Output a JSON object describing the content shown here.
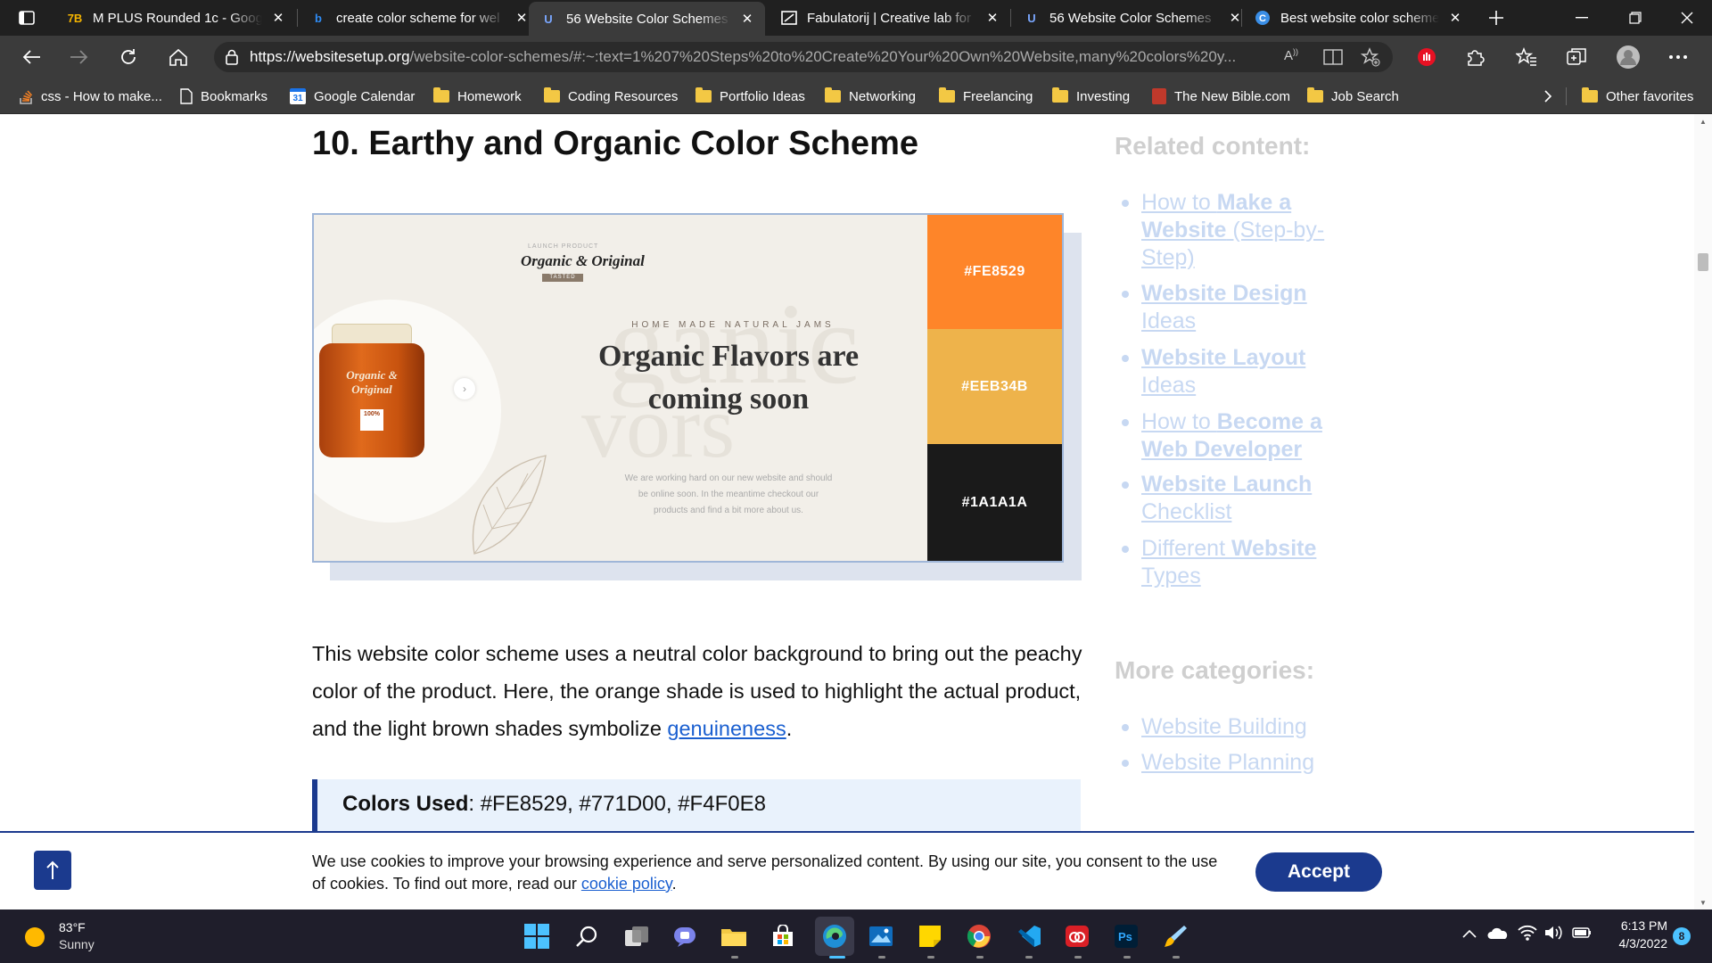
{
  "browser": {
    "tabs": [
      {
        "title": "M PLUS Rounded 1c - Goog",
        "favicon": "google-fonts-icon"
      },
      {
        "title": "create color scheme for wel",
        "favicon": "bing-icon"
      },
      {
        "title": "56 Website Color Schemes",
        "favicon": "websitesetup-icon",
        "active": true
      },
      {
        "title": "Fabulatorij | Creative lab for",
        "favicon": "fabulatorij-icon"
      },
      {
        "title": "56 Website Color Schemes",
        "favicon": "websitesetup-icon"
      },
      {
        "title": "Best website color scheme",
        "favicon": "edge-copilot-icon"
      }
    ],
    "address": {
      "domain": "https://websitesetup.org",
      "path": "/website-color-schemes/#:~:text=1%207%20Steps%20to%20Create%20Your%20Own%20Website,many%20colors%20y..."
    },
    "bookmarks": [
      {
        "label": "css - How to make...",
        "icon": "stackoverflow-icon"
      },
      {
        "label": "Bookmarks",
        "icon": "page-icon"
      },
      {
        "label": "Google Calendar",
        "icon": "calendar-icon",
        "badge": "31"
      },
      {
        "label": "Homework",
        "icon": "folder-icon"
      },
      {
        "label": "Coding Resources",
        "icon": "folder-icon"
      },
      {
        "label": "Portfolio Ideas",
        "icon": "folder-icon"
      },
      {
        "label": "Networking",
        "icon": "folder-icon"
      },
      {
        "label": "Freelancing",
        "icon": "folder-icon"
      },
      {
        "label": "Investing",
        "icon": "folder-icon"
      },
      {
        "label": "The New Bible.com",
        "icon": "bible-icon"
      },
      {
        "label": "Job Search",
        "icon": "folder-icon"
      }
    ],
    "other_favorites": "Other favorites"
  },
  "article": {
    "heading": "10. Earthy and Organic Color Scheme",
    "preview": {
      "eyebrow": "LAUNCH PRODUCT",
      "brand": "Organic & Original",
      "brand_tag": "TASTED",
      "subhead": "HOME MADE NATURAL JAMS",
      "headline_1": "Organic Flavors are",
      "headline_2": "coming soon",
      "body_1": "We are working hard on our new website and should",
      "body_2": "be online soon. In the meantime checkout our",
      "body_3": "products and find a bit more about us.",
      "jar_label": "Organic & Original",
      "jar_badge": "100%",
      "swatches": [
        {
          "hex": "#FE8529",
          "color": "#FE8529"
        },
        {
          "hex": "#EEB34B",
          "color": "#EEB34B"
        },
        {
          "hex": "#1A1A1A",
          "color": "#1A1A1A"
        }
      ]
    },
    "para_before": "This website color scheme uses a neutral color background to bring out the peachy color of the product. Here, the orange shade is used to highlight the actual product, and the light brown shades symbolize ",
    "para_link": "genuineness",
    "para_after": ".",
    "colors_label": "Colors Used",
    "colors_value": ": #FE8529, #771D00, #F4F0E8"
  },
  "sidebar": {
    "related_heading": "Related content:",
    "related": [
      {
        "pre": "How to ",
        "bold": "Make a Website",
        "post": " (Step-by-Step)"
      },
      {
        "pre": "",
        "bold": "Website Design",
        "post": " Ideas"
      },
      {
        "pre": "",
        "bold": "Website Layout",
        "post": " Ideas"
      },
      {
        "pre": "How to ",
        "bold": "Become a Web Developer",
        "post": ""
      },
      {
        "pre": "",
        "bold": "Website Launch",
        "post": " Checklist"
      },
      {
        "pre": "Different ",
        "bold": "Website",
        "post": " Types"
      }
    ],
    "more_heading": "More categories:",
    "more": [
      "Website Building",
      "Website Planning"
    ]
  },
  "cookie": {
    "text": "We use cookies to improve your browsing experience and serve personalized content. By using our site, you consent to the use of cookies. To find out more, read our ",
    "link": "cookie policy",
    "after": ".",
    "accept": "Accept"
  },
  "taskbar": {
    "weather_temp": "83°F",
    "weather_desc": "Sunny",
    "time": "6:13 PM",
    "date": "4/3/2022",
    "notification_count": "8",
    "apps": [
      "windows-start-icon",
      "search-icon",
      "task-view-icon",
      "teams-chat-icon",
      "file-explorer-icon",
      "microsoft-store-icon",
      "edge-icon",
      "photos-icon",
      "sticky-notes-icon",
      "chrome-icon",
      "vscode-icon",
      "creative-cloud-icon",
      "photoshop-icon",
      "paint-brush-icon"
    ]
  }
}
